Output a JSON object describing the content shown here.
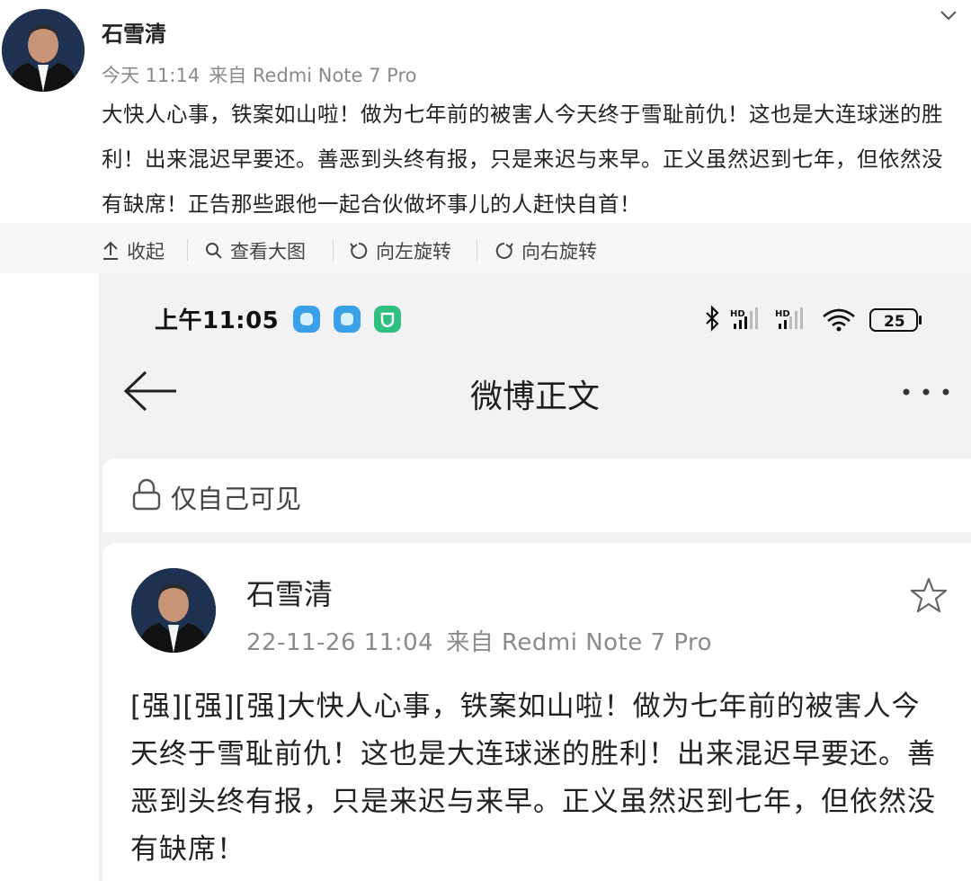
{
  "post": {
    "author": "石雪清",
    "time": "今天 11:14",
    "source": "来自 Redmi Note 7 Pro",
    "text": "大快人心事，铁案如山啦！做为七年前的被害人今天终于雪耻前仇！这也是大连球迷的胜利！出来混迟早要还。善恶到头终有报，只是来迟与来早。正义虽然迟到七年，但依然没有缺席！正告那些跟他一起合伙做坏事儿的人赶快自首！"
  },
  "toolbar": {
    "collapse": "收起",
    "view_large": "查看大图",
    "rotate_left": "向左旋转",
    "rotate_right": "向右旋转"
  },
  "screenshot": {
    "status": {
      "time": "上午11:05",
      "battery": "25",
      "hd1": "HD",
      "hd2": "HD"
    },
    "nav_title": "微博正文",
    "visibility": "仅自己可见",
    "author": "石雪清",
    "date": "22-11-26 11:04",
    "source": "来自 Redmi Note 7 Pro",
    "text": "[强][强][强]大快人心事，铁案如山啦！做为七年前的被害人今天终于雪耻前仇！这也是大连球迷的胜利！出来混迟早要还。善恶到头终有报，只是来迟与来早。正义虽然迟到七年，但依然没有缺席！"
  },
  "colors": {
    "badge1": "#3aa0e8",
    "badge2": "#3aa0e8",
    "badge3": "#2fbf7f",
    "meta": "#8a8a8a"
  },
  "icons": [
    "chevron-down-icon",
    "collapse-icon",
    "search-icon",
    "rotate-left-icon",
    "rotate-right-icon",
    "back-arrow-icon",
    "more-icon",
    "lock-icon",
    "star-icon",
    "bluetooth-icon",
    "wifi-icon",
    "battery-icon"
  ]
}
